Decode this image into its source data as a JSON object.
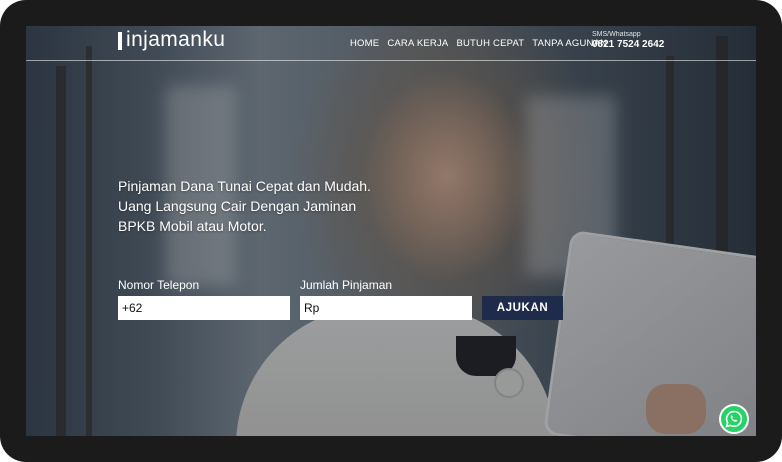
{
  "nav": {
    "logo_mark": "P",
    "logo_text": "injamanku",
    "links": [
      "HOME",
      "CARA KERJA",
      "BUTUH CEPAT",
      "TANPA AGUNAN"
    ],
    "contact_label": "SMS/Whatsapp",
    "contact_number": "0821 7524 2642"
  },
  "hero": {
    "lines": [
      "Pinjaman Dana Tunai Cepat dan Mudah.",
      "Uang Langsung Cair Dengan Jaminan",
      "BPKB Mobil atau Motor."
    ]
  },
  "form": {
    "phone_label": "Nomor Telepon",
    "phone_value": "+62",
    "amount_label": "Jumlah Pinjaman",
    "amount_value": "Rp",
    "submit_label": "AJUKAN"
  },
  "icons": {
    "whatsapp": "whatsapp-icon"
  },
  "colors": {
    "button": "#1f2b4b",
    "whatsapp": "#25d366"
  }
}
